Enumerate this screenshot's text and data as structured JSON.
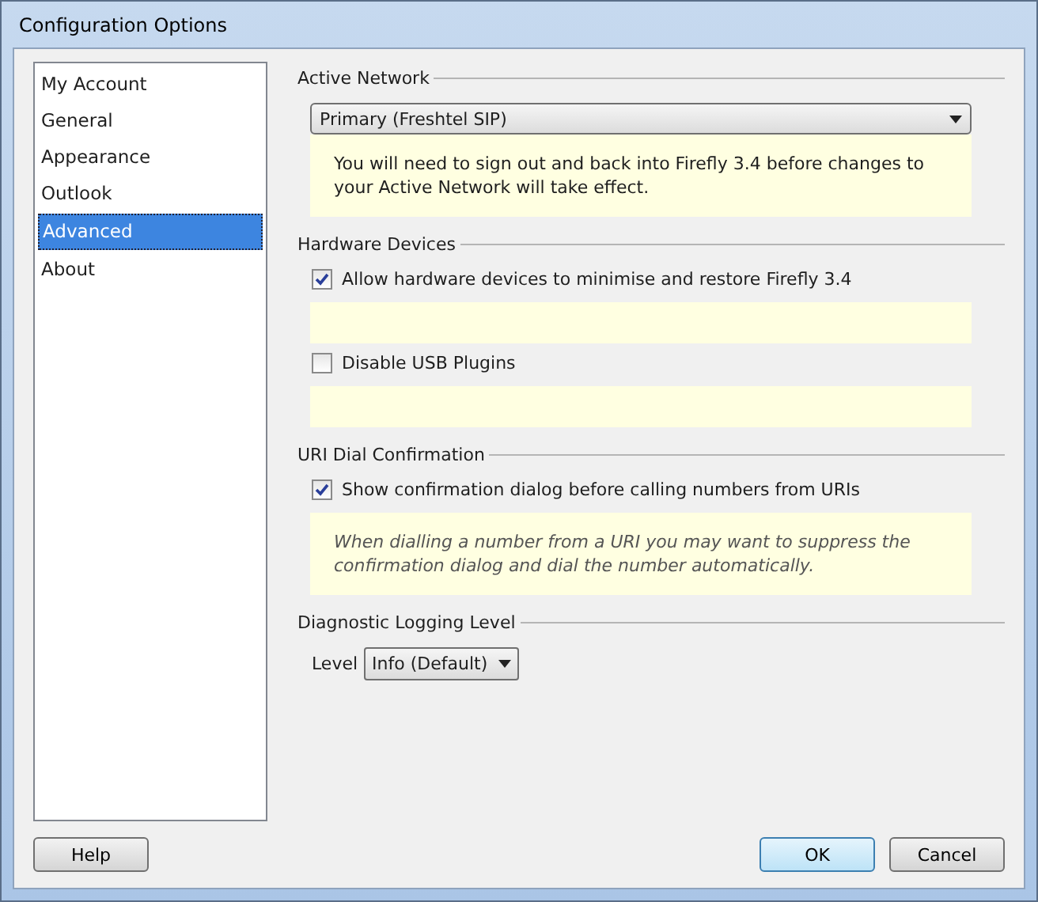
{
  "window": {
    "title": "Configuration Options"
  },
  "sidebar": {
    "items": [
      {
        "label": "My Account",
        "selected": false
      },
      {
        "label": "General",
        "selected": false
      },
      {
        "label": "Appearance",
        "selected": false
      },
      {
        "label": "Outlook",
        "selected": false
      },
      {
        "label": "Advanced",
        "selected": true
      },
      {
        "label": "About",
        "selected": false
      }
    ]
  },
  "sections": [
    {
      "title": "Active Network",
      "items": [
        {
          "kind": "dropdown",
          "value": "Primary (Freshtel SIP)"
        },
        {
          "kind": "note",
          "italic": false,
          "text": "You will need to sign out and back into Firefly 3.4 before changes to your Active Network will take effect."
        }
      ]
    },
    {
      "title": "Hardware Devices",
      "items": [
        {
          "kind": "checkbox",
          "label": "Allow hardware devices to minimise and restore Firefly 3.4",
          "checked": true
        },
        {
          "kind": "note"
        },
        {
          "kind": "checkbox",
          "label": "Disable USB Plugins",
          "checked": false
        },
        {
          "kind": "note"
        }
      ]
    },
    {
      "title": "URI Dial Confirmation",
      "items": [
        {
          "kind": "checkbox",
          "label": "Show confirmation dialog before calling numbers from URIs",
          "checked": true
        },
        {
          "kind": "note",
          "italic": true,
          "text": "When dialling a number from a URI you may want to suppress the confirmation dialog and dial the number automatically."
        }
      ]
    },
    {
      "title": "Diagnostic Logging Level",
      "items": [
        {
          "kind": "select",
          "label": "Level",
          "value": "Info (Default)"
        }
      ]
    }
  ],
  "buttons": {
    "help": "Help",
    "ok": "OK",
    "cancel": "Cancel"
  }
}
